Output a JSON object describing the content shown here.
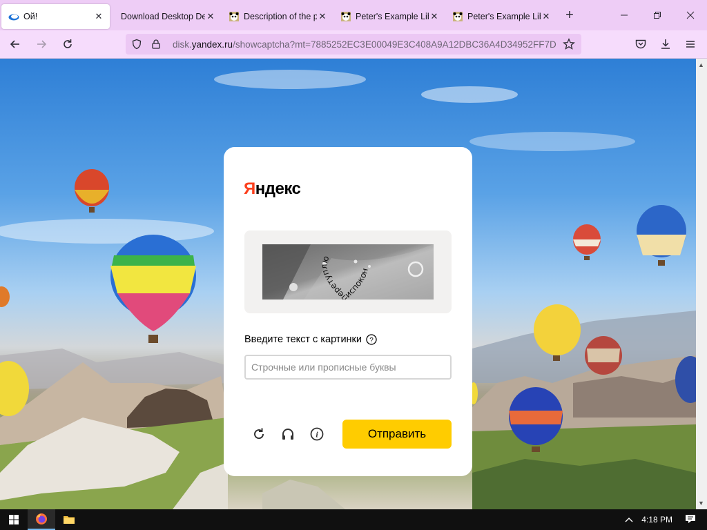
{
  "browser": {
    "tabs": [
      {
        "title": "Ой!",
        "favicon": "yandex-disk-icon",
        "active": true
      },
      {
        "title": "Download Desktop Desktop",
        "favicon": "none",
        "active": false
      },
      {
        "title": "Description of the problem",
        "favicon": "panda-icon",
        "active": false
      },
      {
        "title": "Peter's Example Library",
        "favicon": "panda-icon",
        "active": false
      },
      {
        "title": "Peter's Example Library",
        "favicon": "panda-icon",
        "active": false
      }
    ],
    "new_tab_label": "+",
    "url": {
      "prefix": "disk.",
      "host": "yandex.ru",
      "path": "/showcaptcha?mt=7885252EC3E00049E3C408A9A12DBC36A4D34952FF7D"
    }
  },
  "captcha": {
    "logo_first": "Я",
    "logo_rest": "ндекс",
    "captcha_words": [
      "перетуплю",
      "испокон"
    ],
    "prompt": "Введите текст с картинки",
    "input": {
      "value": "",
      "placeholder": "Строчные или прописные буквы"
    },
    "submit_label": "Отправить",
    "icons": [
      "refresh-icon",
      "audio-icon",
      "info-icon"
    ]
  },
  "taskbar": {
    "time": "4:18 PM"
  },
  "colors": {
    "accent_yellow": "#ffcc00",
    "logo_red": "#fc3f1d",
    "tabstrip": "#eecdf6"
  }
}
